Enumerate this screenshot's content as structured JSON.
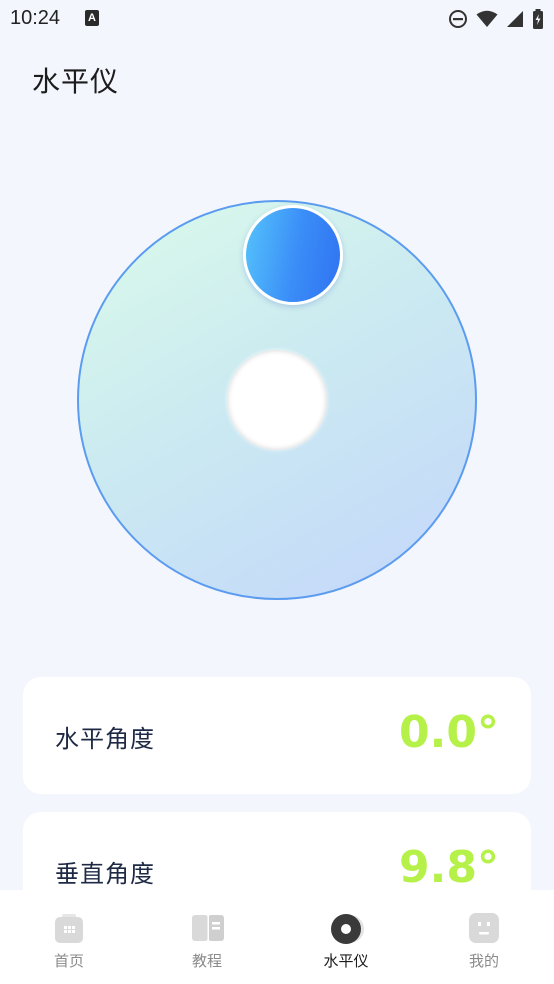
{
  "status_bar": {
    "time": "10:24",
    "notification_glyph": "A"
  },
  "page": {
    "title": "水平仪"
  },
  "level": {
    "disk_colors": [
      "#dbfbea",
      "#c4d6fb"
    ],
    "bubble_colors": [
      "#55c3fb",
      "#2f73f2"
    ]
  },
  "cards": {
    "horizontal": {
      "label": "水平角度",
      "value": "0.0°"
    },
    "vertical": {
      "label": "垂直角度",
      "value": "9.8°"
    }
  },
  "value_color": "#b6f14a",
  "bottom_nav": {
    "items": [
      {
        "label": "首页",
        "icon": "home-grid-icon",
        "active": false
      },
      {
        "label": "教程",
        "icon": "book-icon",
        "active": false
      },
      {
        "label": "水平仪",
        "icon": "level-disc-icon",
        "active": true
      },
      {
        "label": "我的",
        "icon": "profile-face-icon",
        "active": false
      }
    ]
  }
}
